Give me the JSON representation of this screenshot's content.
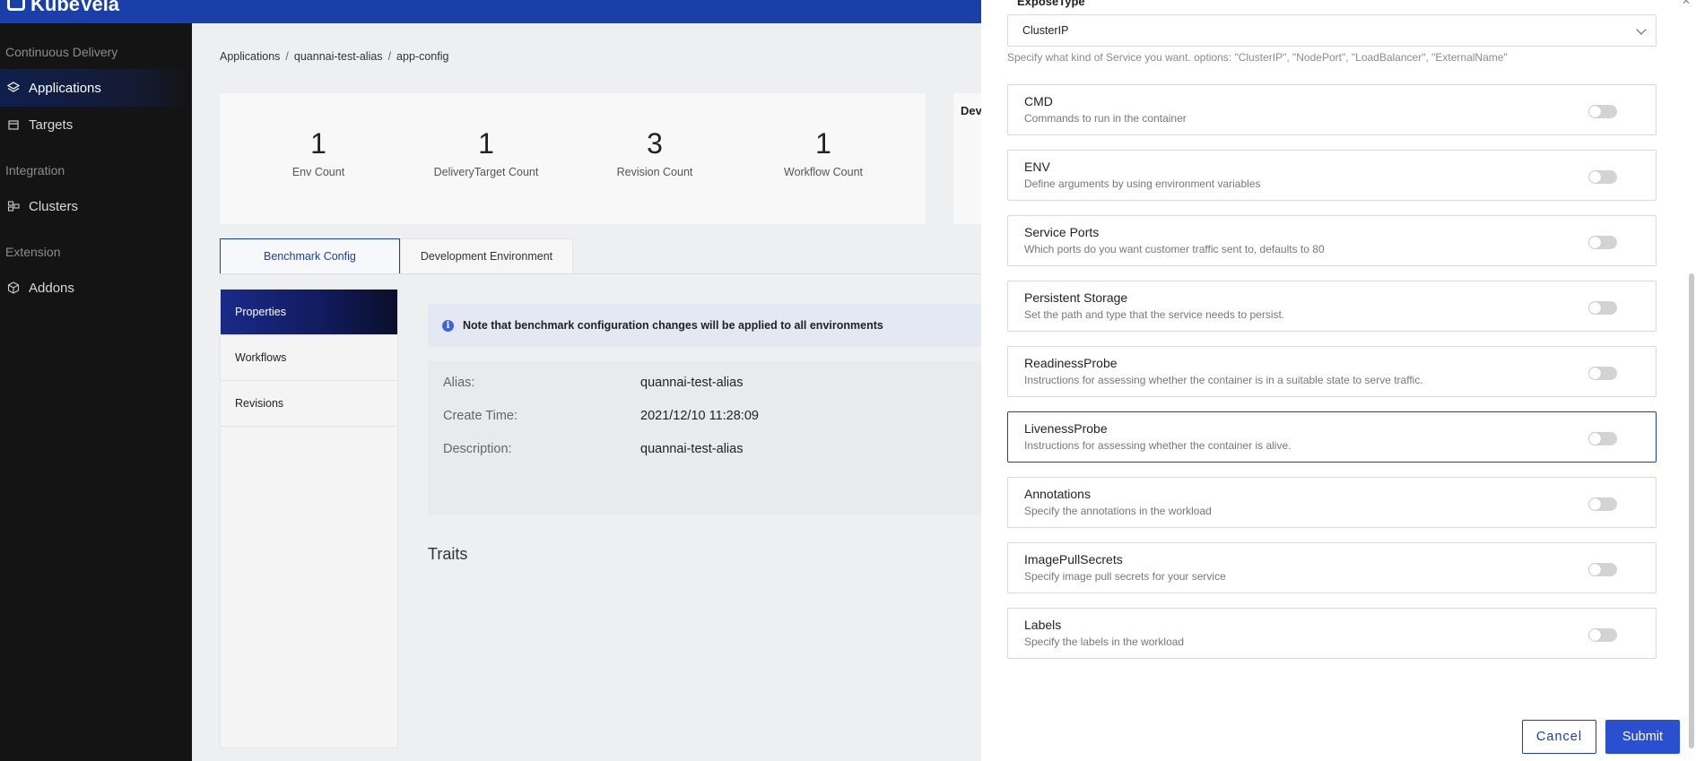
{
  "brand": {
    "name": "KubeVela"
  },
  "sidebar": {
    "groups": [
      {
        "label": "Continuous Delivery"
      },
      {
        "label": "Integration"
      },
      {
        "label": "Extension"
      }
    ],
    "items": [
      {
        "label": "Applications",
        "icon": "layers-icon",
        "active": true
      },
      {
        "label": "Targets",
        "icon": "target-icon",
        "active": false
      },
      {
        "label": "Clusters",
        "icon": "cluster-icon",
        "active": false
      },
      {
        "label": "Addons",
        "icon": "addon-icon",
        "active": false
      }
    ]
  },
  "breadcrumb": {
    "items": [
      "Applications",
      "quannai-test-alias",
      "app-config"
    ],
    "separator": "/"
  },
  "stats": [
    {
      "value": "1",
      "label": "Env Count"
    },
    {
      "value": "1",
      "label": "DeliveryTarget Count"
    },
    {
      "value": "3",
      "label": "Revision Count"
    },
    {
      "value": "1",
      "label": "Workflow Count"
    }
  ],
  "right_card": {
    "title": "Dev"
  },
  "tabs": [
    {
      "label": "Benchmark Config",
      "active": true
    },
    {
      "label": "Development Environment",
      "active": false
    }
  ],
  "left_nav": [
    {
      "label": "Properties",
      "active": true
    },
    {
      "label": "Workflows",
      "active": false
    },
    {
      "label": "Revisions",
      "active": false
    }
  ],
  "notice": {
    "text": "Note that benchmark configuration changes will be applied to all environments"
  },
  "details": {
    "rows": [
      {
        "key": "Alias:",
        "value": "quannai-test-alias"
      },
      {
        "key": "Create Time:",
        "value": "2021/12/10 11:28:09"
      },
      {
        "key": "Description:",
        "value": "quannai-test-alias"
      }
    ]
  },
  "traits": {
    "title": "Traits"
  },
  "drawer": {
    "field_label": "ExposeType",
    "select_value": "ClusterIP",
    "help": "Specify what kind of Service you want. options: \"ClusterIP\", \"NodePort\", \"LoadBalancer\", \"ExternalName\"",
    "options": [
      {
        "title": "CMD",
        "desc": "Commands to run in the container",
        "enabled": false
      },
      {
        "title": "ENV",
        "desc": "Define arguments by using environment variables",
        "enabled": false
      },
      {
        "title": "Service Ports",
        "desc": "Which ports do you want customer traffic sent to, defaults to 80",
        "enabled": false
      },
      {
        "title": "Persistent Storage",
        "desc": "Set the path and type that the service needs to persist.",
        "enabled": false
      },
      {
        "title": "ReadinessProbe",
        "desc": "Instructions for assessing whether the container is in a suitable state to serve traffic.",
        "enabled": false
      },
      {
        "title": "LivenessProbe",
        "desc": "Instructions for assessing whether the container is alive.",
        "enabled": false
      },
      {
        "title": "Annotations",
        "desc": "Specify the annotations in the workload",
        "enabled": false
      },
      {
        "title": "ImagePullSecrets",
        "desc": "Specify image pull secrets for your service",
        "enabled": false
      },
      {
        "title": "Labels",
        "desc": "Specify the labels in the workload",
        "enabled": false
      }
    ],
    "cancel_label": "Cancel",
    "submit_label": "Submit"
  },
  "colors": {
    "primary": "#1a3fa8",
    "sidebar_bg": "#141414"
  }
}
